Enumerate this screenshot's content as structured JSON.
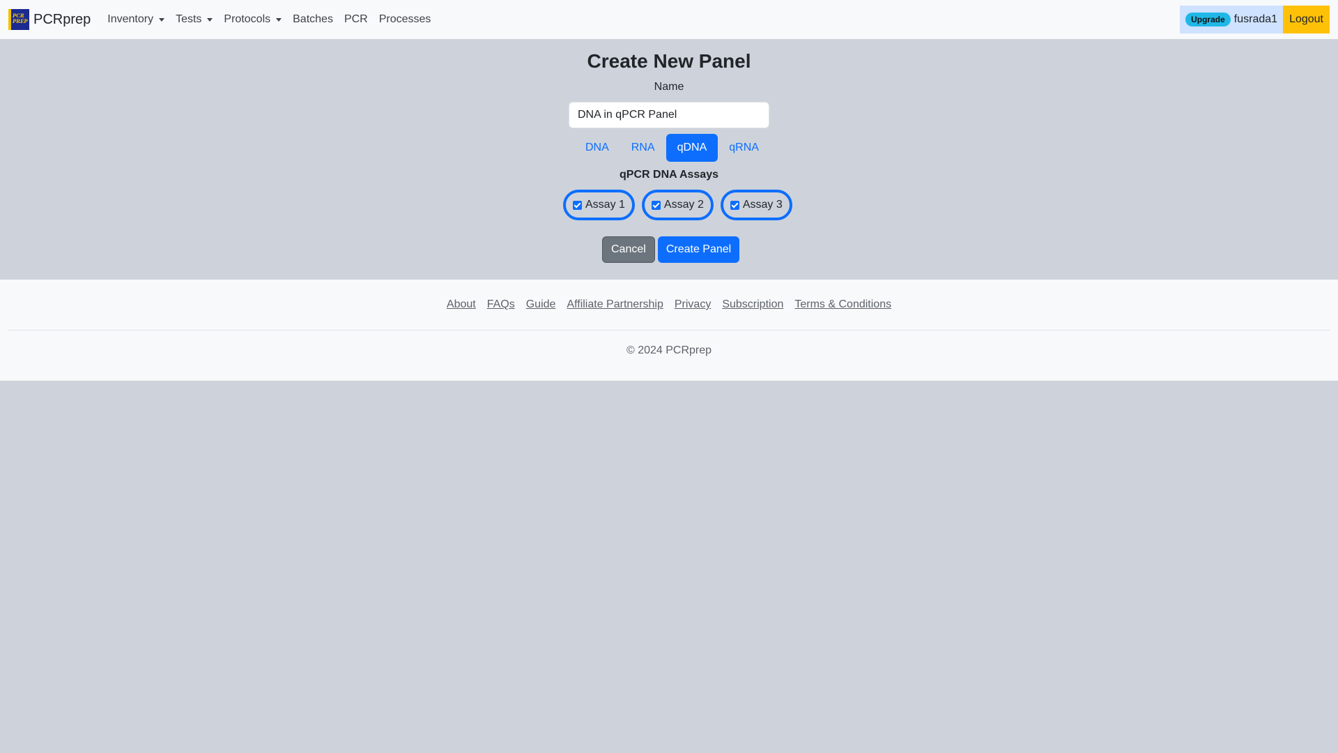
{
  "navbar": {
    "brand": "PCRprep",
    "logo_text": "PCR PREP",
    "links": [
      {
        "label": "Inventory",
        "dropdown": true
      },
      {
        "label": "Tests",
        "dropdown": true
      },
      {
        "label": "Protocols",
        "dropdown": true
      },
      {
        "label": "Batches",
        "dropdown": false
      },
      {
        "label": "PCR",
        "dropdown": false
      },
      {
        "label": "Processes",
        "dropdown": false
      }
    ],
    "upgrade_label": "Upgrade",
    "username": "fusrada1",
    "logout_label": "Logout"
  },
  "form": {
    "title": "Create New Panel",
    "name_label": "Name",
    "name_value": "DNA in qPCR Panel",
    "types": [
      {
        "label": "DNA",
        "active": false
      },
      {
        "label": "RNA",
        "active": false
      },
      {
        "label": "qDNA",
        "active": true
      },
      {
        "label": "qRNA",
        "active": false
      }
    ],
    "assays_title": "qPCR DNA Assays",
    "assays": [
      {
        "label": "Assay 1",
        "checked": true
      },
      {
        "label": "Assay 2",
        "checked": true
      },
      {
        "label": "Assay 3",
        "checked": true
      }
    ],
    "cancel_label": "Cancel",
    "create_label": "Create Panel"
  },
  "footer": {
    "links": [
      "About",
      "FAQs",
      "Guide",
      "Affiliate Partnership",
      "Privacy",
      "Subscription",
      "Terms & Conditions"
    ],
    "copyright": "© 2024 PCRprep"
  },
  "colors": {
    "primary": "#0d6efd",
    "secondary": "#6c757d",
    "warning": "#ffc107",
    "info": "#1fb8e6",
    "background": "#ced3db",
    "navbar_bg": "#f8f9fa"
  }
}
